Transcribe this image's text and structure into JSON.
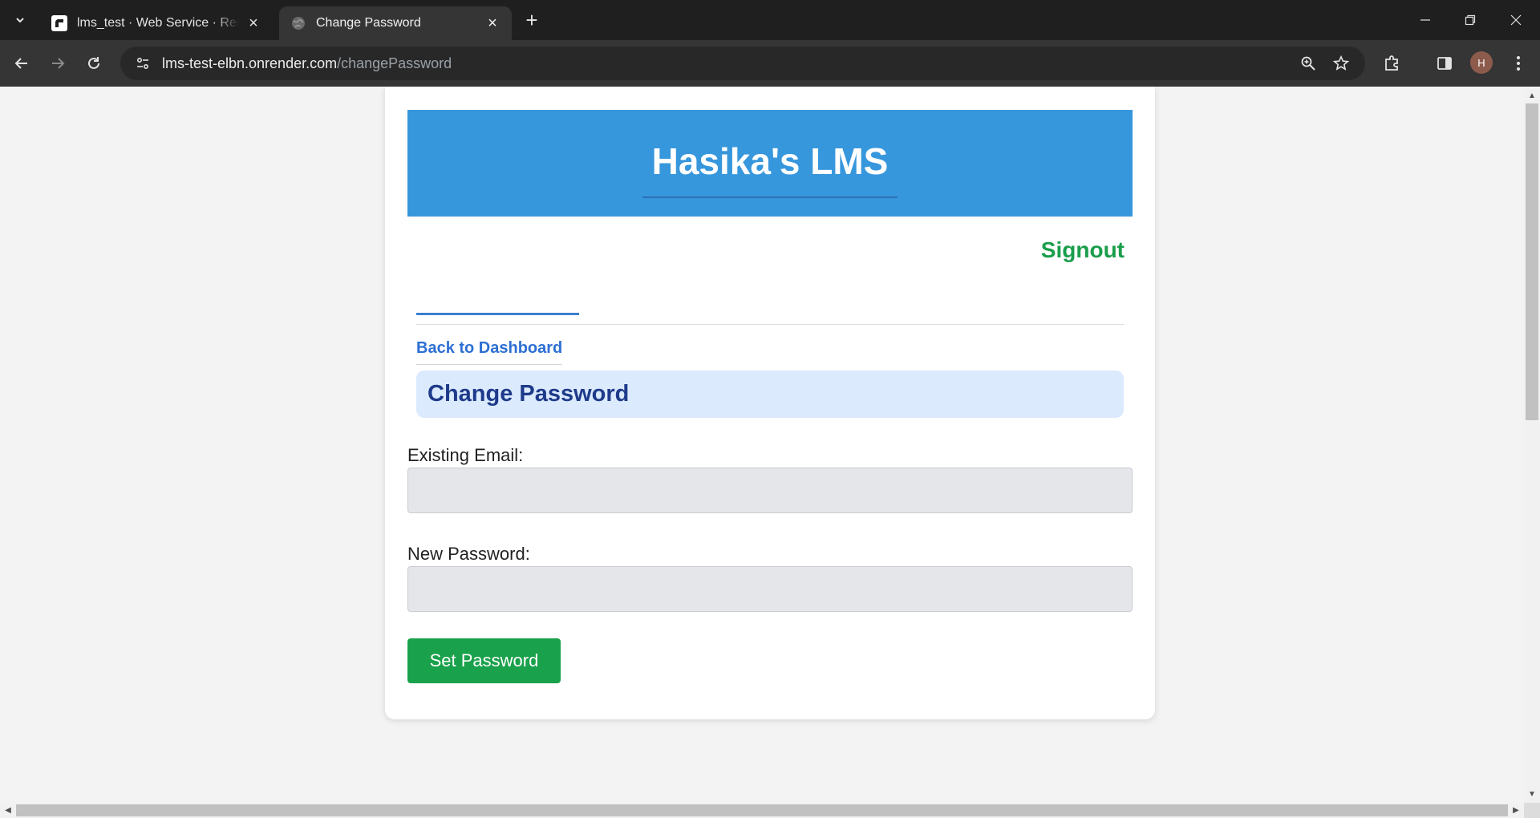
{
  "browser": {
    "tabs": [
      {
        "title": "lms_test · Web Service · Render",
        "icon": "render-logo-icon",
        "active": false
      },
      {
        "title": "Change Password",
        "icon": "globe-icon",
        "active": true
      }
    ],
    "address": {
      "host": "lms-test-elbn.onrender.com",
      "path": "/changePassword"
    },
    "profile_initial": "H"
  },
  "page": {
    "header_title": "Hasika's LMS",
    "signout_label": "Signout",
    "back_link": "Back to Dashboard",
    "section_title": "Change Password",
    "form": {
      "email_label": "Existing Email:",
      "email_value": "",
      "password_label": "New Password:",
      "password_value": "",
      "submit_label": "Set Password"
    }
  },
  "colors": {
    "header_bg": "#3797dc",
    "signout": "#1a9e4b",
    "link": "#2d6fd3",
    "section_bg": "#dbeafd",
    "section_text": "#1e3a8a",
    "submit_bg": "#1aa14b"
  }
}
